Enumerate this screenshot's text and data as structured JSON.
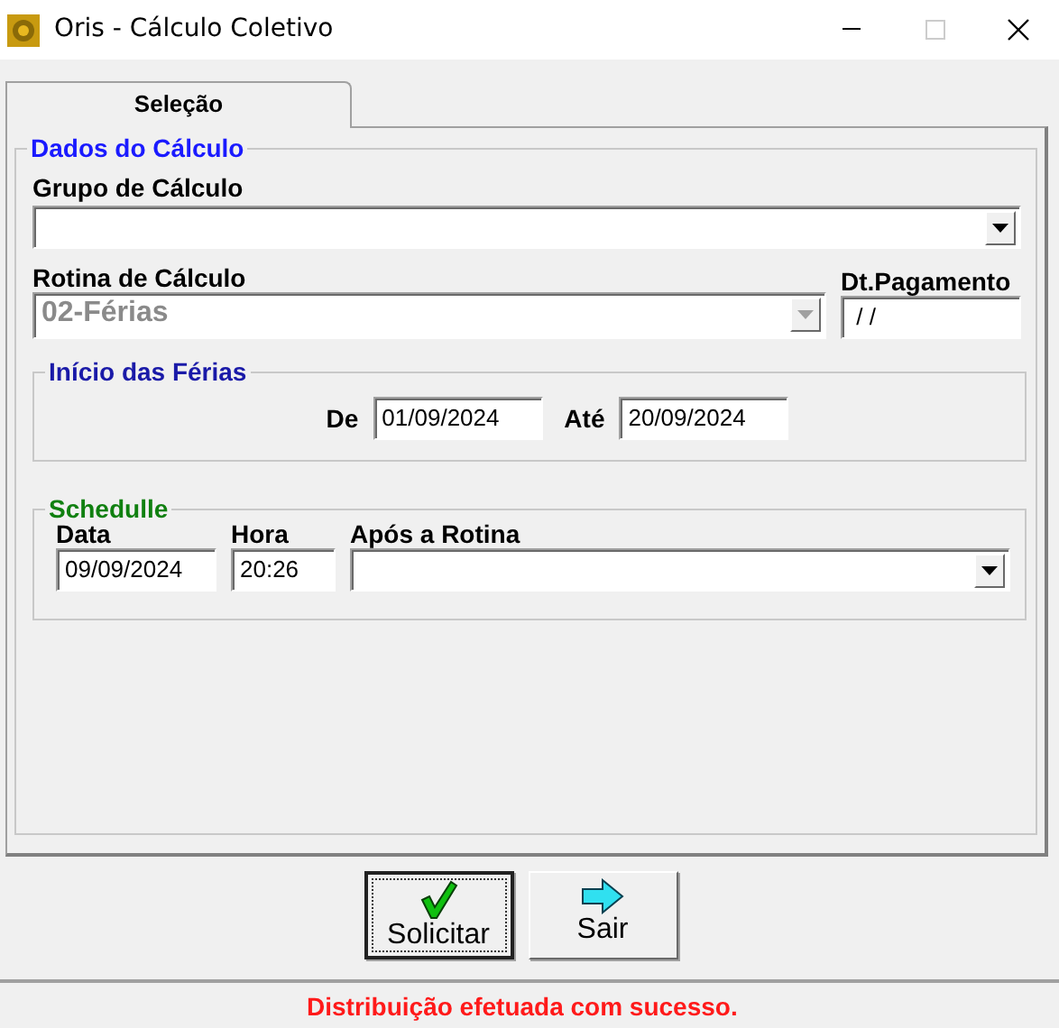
{
  "window": {
    "title": "Oris - Cálculo Coletivo"
  },
  "tabs": [
    {
      "label": "Seleção",
      "selected": true
    }
  ],
  "dados_do_calculo": {
    "legend": "Dados do Cálculo",
    "grupo_de_calculo": {
      "label": "Grupo de Cálculo",
      "disabled": false
    },
    "rotina_de_calculo": {
      "label": "Rotina de Cálculo",
      "value": "02-Férias",
      "disabled": true
    },
    "dt_pagamento": {
      "label": "Dt.Pagamento",
      "value": " / /"
    },
    "inicio_das_ferias": {
      "legend": "Início das Férias",
      "de": {
        "label": "De",
        "value": "01/09/2024"
      },
      "ate": {
        "label": "Até",
        "value": "20/09/2024"
      }
    },
    "schedulle": {
      "legend": "Schedulle",
      "data": {
        "label": "Data",
        "value": "09/09/2024"
      },
      "hora": {
        "label": "Hora",
        "value": "20:26"
      },
      "apos_a_rotina": {
        "label": "Após a Rotina",
        "disabled": false
      }
    }
  },
  "buttons": [
    {
      "label": "Solicitar",
      "kind": "check",
      "focused": true
    },
    {
      "label": "Sair",
      "kind": "exit",
      "focused": false
    }
  ],
  "status_bar": {
    "message": "Distribuição efetuada com sucesso."
  }
}
